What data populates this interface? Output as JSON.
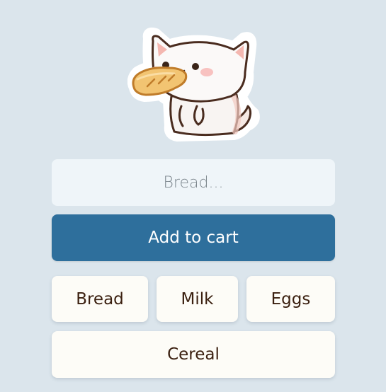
{
  "mascot": {
    "icon": "cat-eating-bread-icon"
  },
  "search": {
    "placeholder": "Bread...",
    "value": ""
  },
  "cart": {
    "add_label": "Add to cart"
  },
  "items": [
    {
      "label": "Bread"
    },
    {
      "label": "Milk"
    },
    {
      "label": "Eggs"
    },
    {
      "label": "Cereal"
    }
  ],
  "colors": {
    "background": "#dbe5ec",
    "primary": "#2e6f9c",
    "item_bg": "#fdfcf7",
    "item_text": "#3b2010",
    "input_bg": "#eff5f9"
  }
}
